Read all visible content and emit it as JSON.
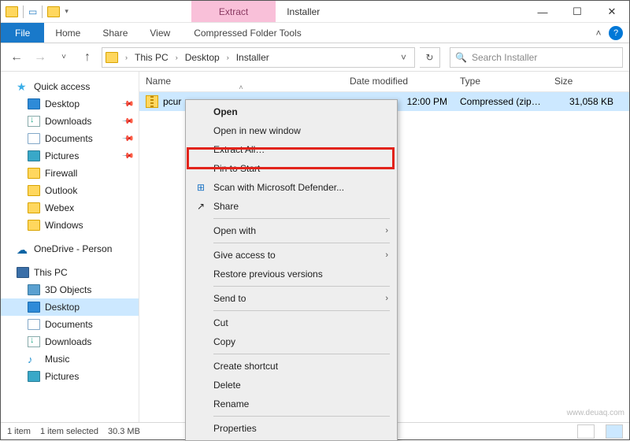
{
  "titlebar": {
    "context_tab": "Extract",
    "window_title": "Installer"
  },
  "ribbon": {
    "file": "File",
    "home": "Home",
    "share": "Share",
    "view": "View",
    "context": "Compressed Folder Tools"
  },
  "breadcrumb": {
    "seg1": "This PC",
    "seg2": "Desktop",
    "seg3": "Installer"
  },
  "search": {
    "placeholder": "Search Installer"
  },
  "sidebar": {
    "quick_access": "Quick access",
    "quick_items": [
      {
        "label": "Desktop"
      },
      {
        "label": "Downloads"
      },
      {
        "label": "Documents"
      },
      {
        "label": "Pictures"
      },
      {
        "label": "Firewall"
      },
      {
        "label": "Outlook"
      },
      {
        "label": "Webex"
      },
      {
        "label": "Windows"
      }
    ],
    "onedrive": "OneDrive - Person",
    "this_pc": "This PC",
    "pc_items": [
      {
        "label": "3D Objects"
      },
      {
        "label": "Desktop"
      },
      {
        "label": "Documents"
      },
      {
        "label": "Downloads"
      },
      {
        "label": "Music"
      },
      {
        "label": "Pictures"
      }
    ]
  },
  "columns": {
    "name": "Name",
    "date": "Date modified",
    "type": "Type",
    "size": "Size"
  },
  "row": {
    "name": "pcur",
    "date": "12:00 PM",
    "type": "Compressed (zipp…",
    "size": "31,058 KB"
  },
  "ctx": {
    "open": "Open",
    "open_new": "Open in new window",
    "extract": "Extract All…",
    "pin": "Pin to Start",
    "defender": "Scan with Microsoft Defender...",
    "share": "Share",
    "open_with": "Open with",
    "give_access": "Give access to",
    "restore": "Restore previous versions",
    "send_to": "Send to",
    "cut": "Cut",
    "copy": "Copy",
    "shortcut": "Create shortcut",
    "delete": "Delete",
    "rename": "Rename",
    "properties": "Properties"
  },
  "status": {
    "count": "1 item",
    "selected": "1 item selected",
    "size": "30.3 MB"
  },
  "watermark": "www.deuaq.com"
}
